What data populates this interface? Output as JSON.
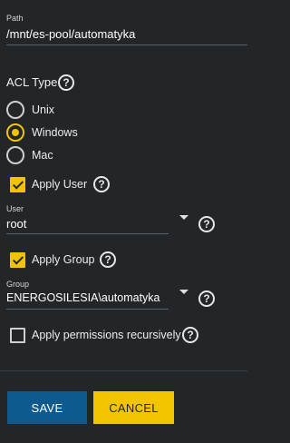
{
  "path": {
    "label": "Path",
    "value": "/mnt/es-pool/automatyka"
  },
  "acl_type": {
    "title": "ACL Type",
    "options": [
      {
        "label": "Unix",
        "checked": false
      },
      {
        "label": "Windows",
        "checked": true
      },
      {
        "label": "Mac",
        "checked": false
      }
    ]
  },
  "apply_user": {
    "label": "Apply User",
    "checked": true
  },
  "user": {
    "label": "User",
    "value": "root"
  },
  "apply_group": {
    "label": "Apply Group",
    "checked": true
  },
  "group": {
    "label": "Group",
    "value": "ENERGOSILESIA\\automatyka"
  },
  "recursive": {
    "label": "Apply permissions recursively",
    "checked": false
  },
  "help_glyph": "?",
  "buttons": {
    "save": "SAVE",
    "cancel": "CANCEL"
  },
  "colors": {
    "accent": "#f0c400",
    "primary": "#0e5a8f",
    "background": "#222629"
  }
}
